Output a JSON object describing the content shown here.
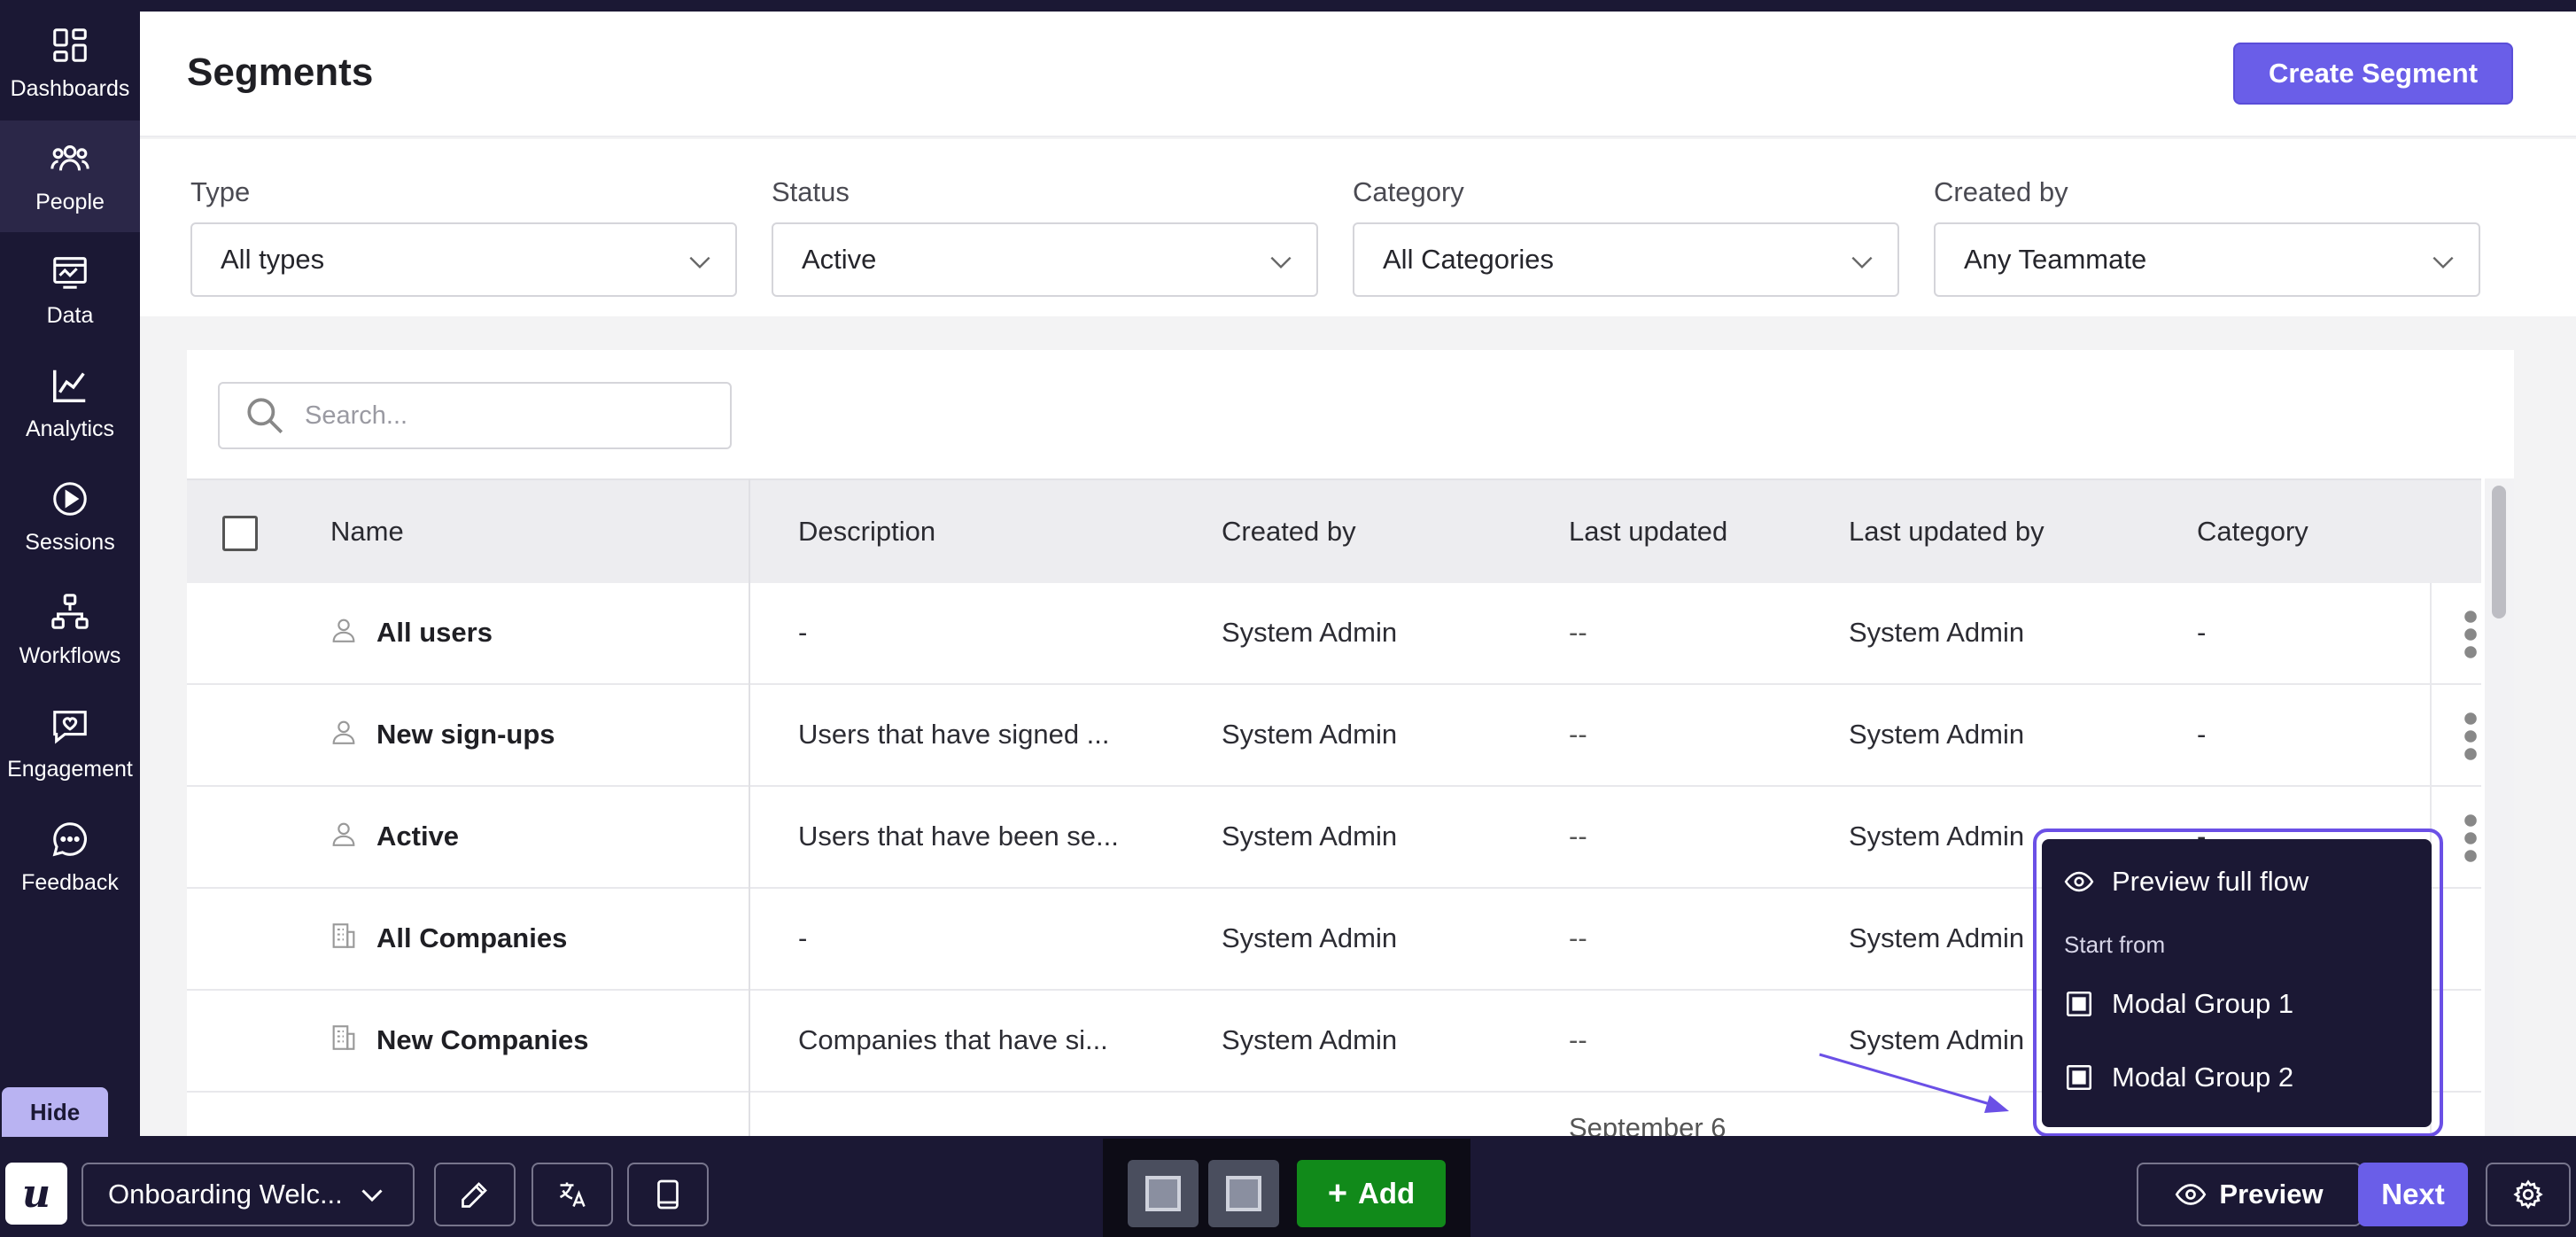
{
  "nav": {
    "items": [
      {
        "label": "Dashboards",
        "icon": "dashboard-icon"
      },
      {
        "label": "People",
        "icon": "people-icon",
        "active": true
      },
      {
        "label": "Data",
        "icon": "data-icon"
      },
      {
        "label": "Analytics",
        "icon": "analytics-icon"
      },
      {
        "label": "Sessions",
        "icon": "sessions-icon"
      },
      {
        "label": "Workflows",
        "icon": "workflows-icon"
      },
      {
        "label": "Engagement",
        "icon": "engagement-icon"
      },
      {
        "label": "Feedback",
        "icon": "feedback-icon"
      }
    ]
  },
  "header": {
    "title": "Segments",
    "create_button": "Create Segment"
  },
  "filters": [
    {
      "label": "Type",
      "value": "All types"
    },
    {
      "label": "Status",
      "value": "Active"
    },
    {
      "label": "Category",
      "value": "All Categories"
    },
    {
      "label": "Created by",
      "value": "Any Teammate"
    }
  ],
  "search": {
    "placeholder": "Search..."
  },
  "table": {
    "columns": [
      "Name",
      "Description",
      "Created by",
      "Last updated",
      "Last updated by",
      "Category"
    ],
    "rows": [
      {
        "icon": "user-icon",
        "name": "All users",
        "description": "-",
        "created_by": "System Admin",
        "last_updated": "--",
        "last_updated_by": "System Admin",
        "category": "-"
      },
      {
        "icon": "user-icon",
        "name": "New sign-ups",
        "description": "Users that have signed ...",
        "created_by": "System Admin",
        "last_updated": "--",
        "last_updated_by": "System Admin",
        "category": "-"
      },
      {
        "icon": "user-icon",
        "name": "Active",
        "description": "Users that have been se...",
        "created_by": "System Admin",
        "last_updated": "--",
        "last_updated_by": "System Admin",
        "category": "-"
      },
      {
        "icon": "building-icon",
        "name": "All Companies",
        "description": "-",
        "created_by": "System Admin",
        "last_updated": "--",
        "last_updated_by": "System Admin",
        "category": ""
      },
      {
        "icon": "building-icon",
        "name": "New Companies",
        "description": "Companies that have si...",
        "created_by": "System Admin",
        "last_updated": "--",
        "last_updated_by": "System Admin",
        "category": ""
      },
      {
        "icon": "",
        "name": "",
        "description": "",
        "created_by": "",
        "last_updated": "September 6",
        "last_updated_by": "",
        "category": ""
      }
    ]
  },
  "preview_menu": {
    "preview_full_flow": "Preview full flow",
    "start_from_label": "Start from",
    "groups": [
      "Modal Group 1",
      "Modal Group 2"
    ]
  },
  "toolbar": {
    "hide_label": "Hide",
    "logo_letter": "u",
    "flow_name": "Onboarding Welc...",
    "add_label": "Add",
    "preview_label": "Preview",
    "next_label": "Next"
  },
  "colors": {
    "brand_dark": "#1b1834",
    "accent": "#6a5ee8",
    "add_green": "#118a1a"
  }
}
